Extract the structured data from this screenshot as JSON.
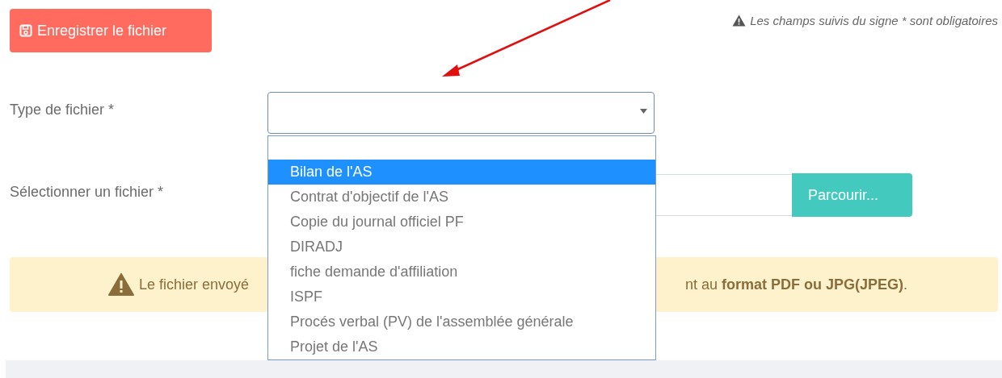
{
  "save_button": {
    "label": "Enregistrer le fichier"
  },
  "required_notice": "Les champs suivis du signe * sont obligatoires",
  "file_type": {
    "label": "Type de fichier *",
    "expanded": true,
    "options": [
      {
        "label": "Bilan de l'AS",
        "selected": true
      },
      {
        "label": "Contrat d'objectif de l'AS",
        "selected": false
      },
      {
        "label": "Copie du journal officiel PF",
        "selected": false
      },
      {
        "label": "DIRADJ",
        "selected": false
      },
      {
        "label": "fiche demande d'affiliation",
        "selected": false
      },
      {
        "label": "ISPF",
        "selected": false
      },
      {
        "label": "Procés verbal (PV) de l'assemblée générale",
        "selected": false
      },
      {
        "label": "Projet de l'AS",
        "selected": false
      }
    ]
  },
  "file_select": {
    "label": "Sélectionner un fichier *",
    "browse_button": "Parcourir..."
  },
  "alert": {
    "texts": [
      "Le fichier envoyé",
      "nt au **format PDF ou JPG(JPEG)**."
    ]
  }
}
